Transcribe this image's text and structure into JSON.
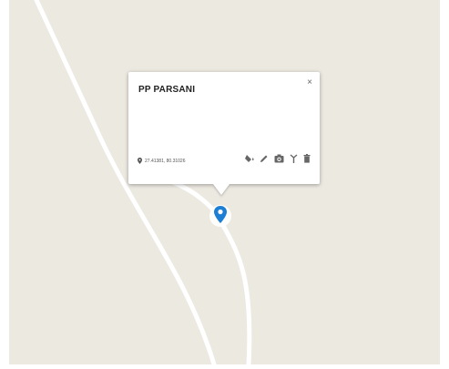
{
  "popup": {
    "title": "PP PARSANI",
    "close_glyph": "×",
    "coordinates": "27.41381, 80.31026"
  },
  "actions": [
    {
      "name": "marker-style-icon"
    },
    {
      "name": "edit-icon"
    },
    {
      "name": "camera-icon"
    },
    {
      "name": "antenna-icon"
    },
    {
      "name": "delete-icon"
    }
  ],
  "colors": {
    "map_background": "#ece9e1",
    "road": "#ffffff",
    "marker": "#1c7fd4"
  }
}
